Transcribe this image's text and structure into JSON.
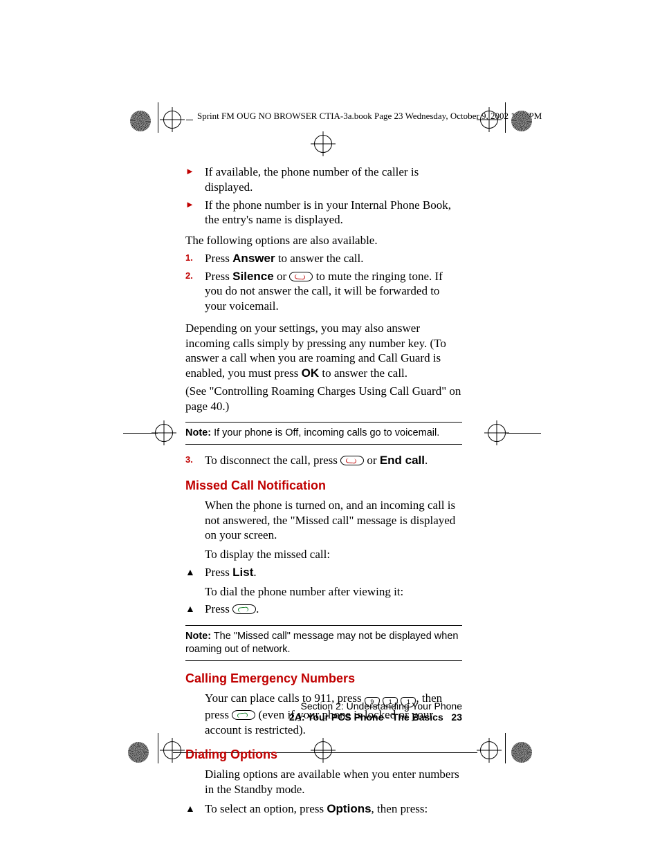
{
  "header": {
    "running": "Sprint FM OUG NO BROWSER CTIA-3a.book  Page 23  Wednesday, October 9, 2002  1:42 PM"
  },
  "bullets": {
    "b1": "If available, the phone number of the caller is displayed.",
    "b2": "If the phone number is in your Internal Phone Book, the entry's name is displayed."
  },
  "p_opts": "The following options are also available.",
  "step1": {
    "pre": "Press ",
    "btn": "Answer",
    "post": " to answer the call."
  },
  "step2": {
    "pre": "Press ",
    "btn": "Silence",
    "mid": " or ",
    "post": " to mute the ringing tone. If you do not answer the call, it will be forwarded to your voicemail."
  },
  "para_roam": {
    "a": "Depending on your settings, you may also answer incoming calls simply by pressing any number key. (To answer a call when you are roaming and Call Guard is enabled, you must press ",
    "ok": "OK",
    "b": " to answer the call.",
    "c": "(See \"Controlling Roaming Charges Using Call Guard\" on page 40.)"
  },
  "note1": {
    "label": "Note:",
    "text": " If your phone is Off, incoming calls go to voicemail."
  },
  "step3": {
    "pre": "To disconnect the call, press ",
    "mid": " or ",
    "btn": "End call",
    "post": "."
  },
  "h_missed": "Missed Call Notification",
  "missed": {
    "p1": "When the phone is turned on, and an incoming call is not answered, the \"Missed call\" message is displayed on your screen.",
    "p2": "To display the missed call:",
    "li1_pre": "Press ",
    "li1_btn": "List",
    "li1_post": ".",
    "p3": "To dial the phone number after viewing it:",
    "li2_pre": "Press ",
    "li2_post": "."
  },
  "note2": {
    "label": "Note:",
    "text": " The \"Missed call\" message may not be displayed when roaming out of network."
  },
  "h_emerg": "Calling Emergency Numbers",
  "emerg": {
    "pre": "Your can place calls to 911, press ",
    "mid": ", then press ",
    "post": " (even if your phone is locked or your account is restricted)."
  },
  "h_dial": "Dialing Options",
  "dial": {
    "p": "Dialing options are available when you enter numbers in the Standby mode.",
    "li_pre": "To select an option, press ",
    "li_btn": "Options",
    "li_post": ", then press:"
  },
  "footer": {
    "section": "Section 2: Understanding Your Phone",
    "sub_a": "2A: Your PCS Phone - The Basics",
    "page": "23"
  },
  "keys": {
    "nine": "9",
    "one1": "1",
    "one2": "1"
  }
}
